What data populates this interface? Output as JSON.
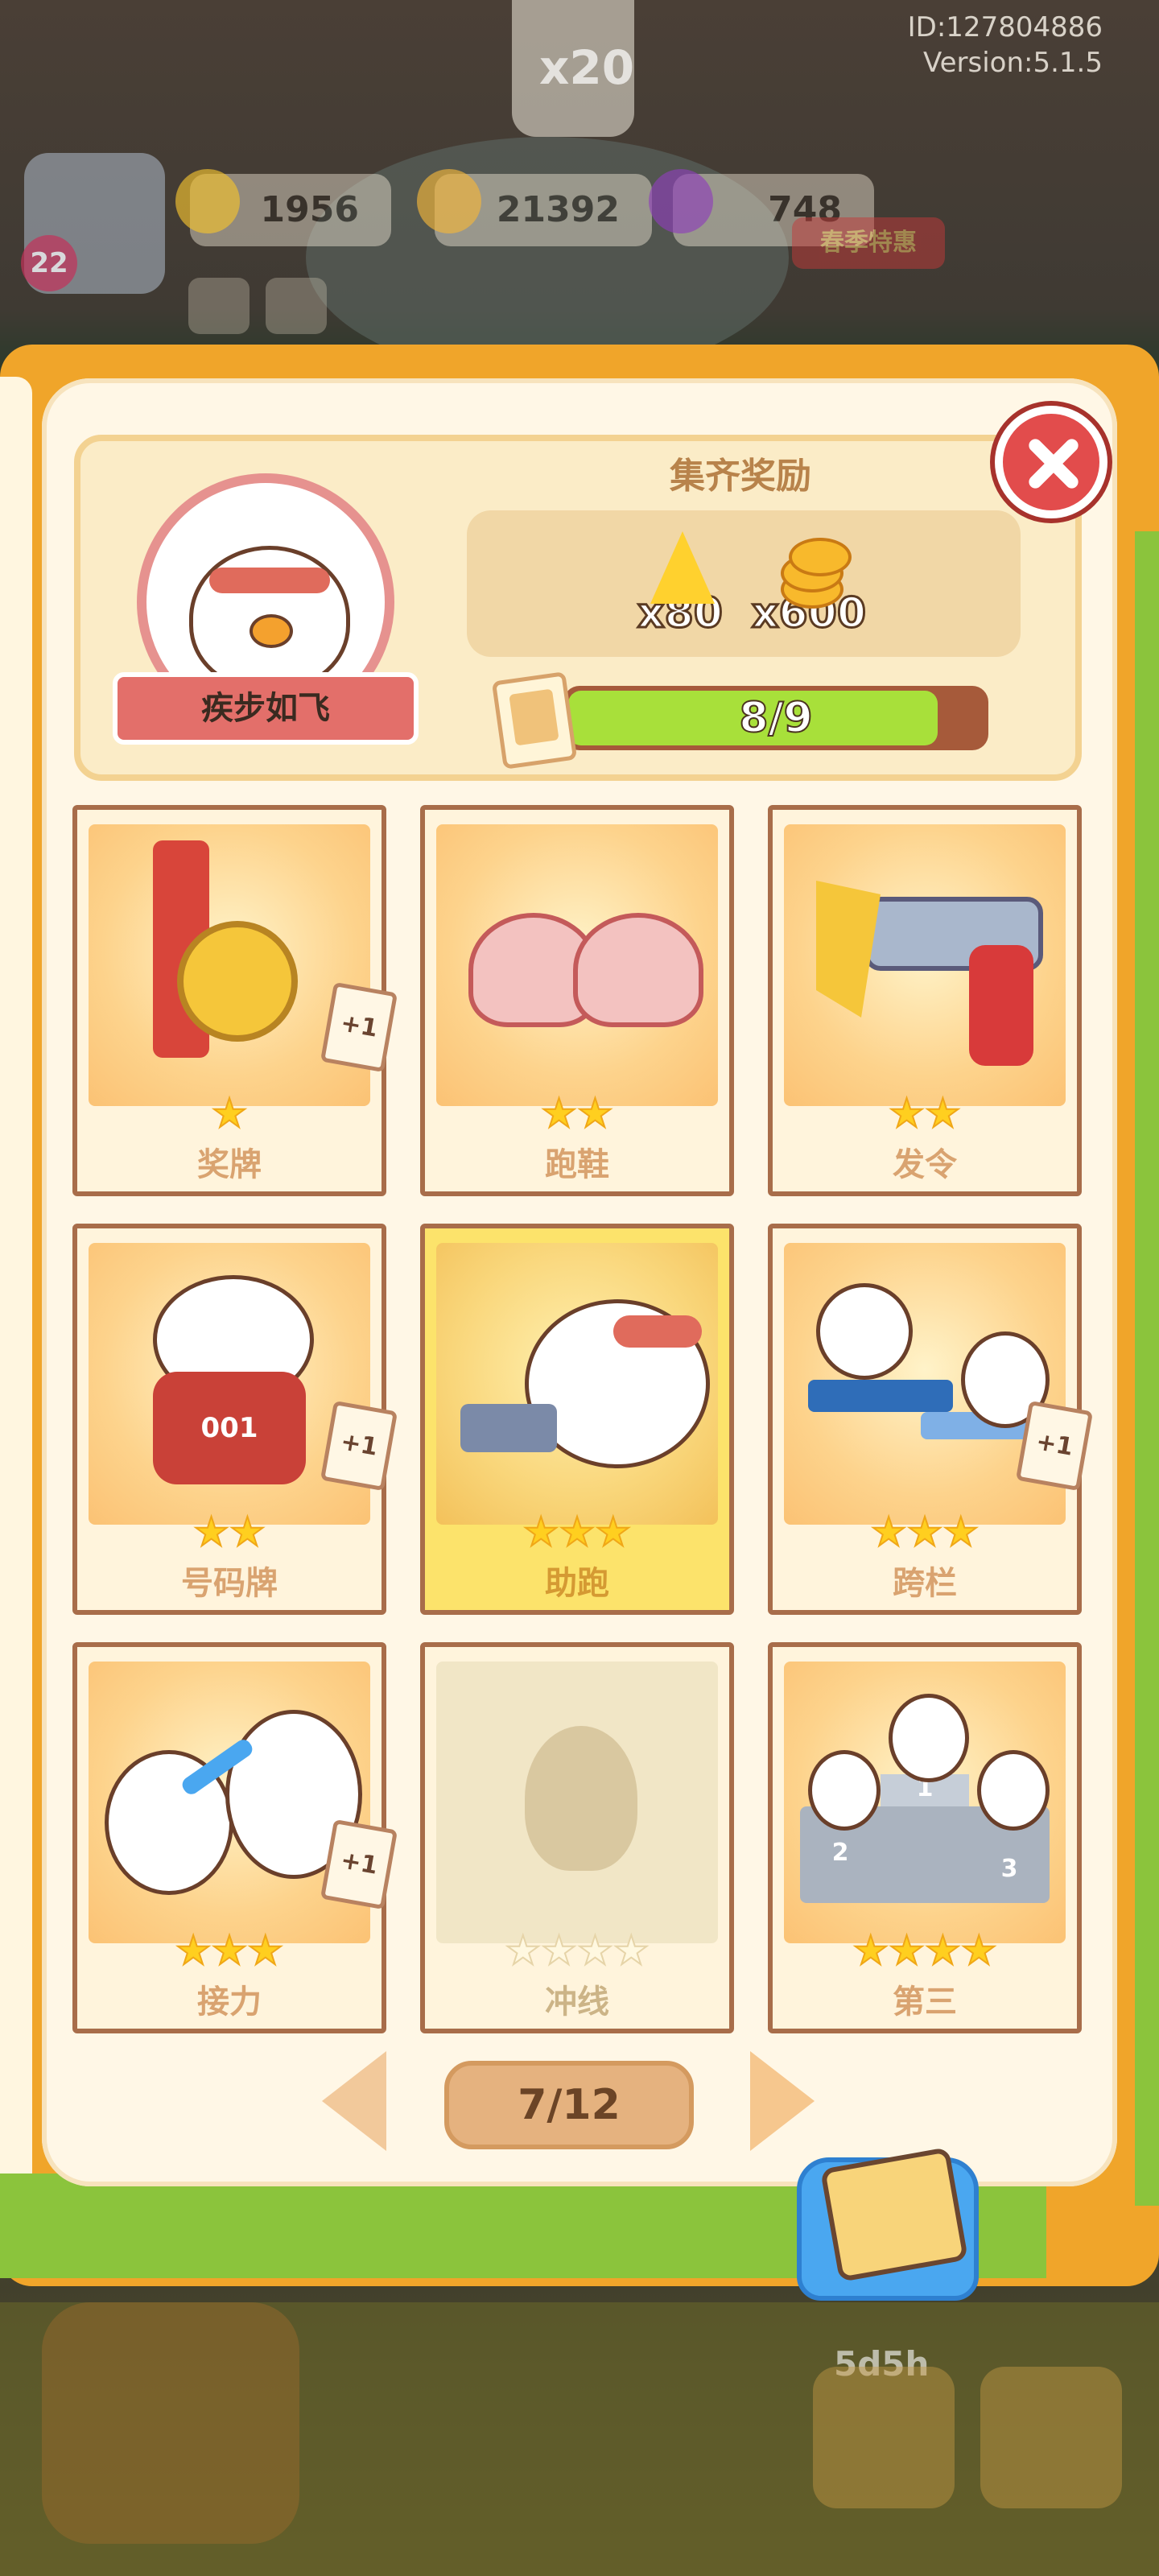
{
  "hud": {
    "id_text": "ID:127804886",
    "version_text": "Version:5.1.5",
    "speech_multiplier": "x20",
    "level": "22",
    "energy": "1956",
    "coins": "21392",
    "gems": "748",
    "sale_label": "春季特惠"
  },
  "collection": {
    "set_name": "疾步如飞",
    "reward_title": "集齐奖励",
    "rewards": [
      {
        "icon": "lightning-icon",
        "qty": "x80"
      },
      {
        "icon": "coin-stack-icon",
        "qty": "x600"
      }
    ],
    "progress_text": "8/9",
    "progress_value": 0.889
  },
  "cards": [
    {
      "name": "奖牌",
      "stars": 1,
      "max_stars": 1,
      "plus_one": true,
      "state": "normal"
    },
    {
      "name": "跑鞋",
      "stars": 2,
      "max_stars": 2,
      "plus_one": false,
      "state": "normal"
    },
    {
      "name": "发令",
      "stars": 2,
      "max_stars": 2,
      "plus_one": false,
      "state": "normal"
    },
    {
      "name": "号码牌",
      "stars": 2,
      "max_stars": 2,
      "plus_one": true,
      "state": "normal"
    },
    {
      "name": "助跑",
      "stars": 3,
      "max_stars": 3,
      "plus_one": false,
      "state": "gold"
    },
    {
      "name": "跨栏",
      "stars": 3,
      "max_stars": 3,
      "plus_one": true,
      "state": "normal"
    },
    {
      "name": "接力",
      "stars": 3,
      "max_stars": 3,
      "plus_one": true,
      "state": "normal"
    },
    {
      "name": "冲线",
      "stars": 0,
      "max_stars": 4,
      "plus_one": false,
      "state": "locked"
    },
    {
      "name": "第三",
      "stars": 4,
      "max_stars": 4,
      "plus_one": false,
      "state": "normal"
    }
  ],
  "card_plus_label": "+1",
  "card_art_numbers": {
    "bib": "001",
    "podium_1": "1",
    "podium_2": "2",
    "podium_3": "3"
  },
  "pagination": {
    "text": "7/12"
  },
  "bottom": {
    "timer": "5d5h"
  },
  "colors": {
    "accent": "#f0a52a",
    "progress_fill": "#a8e03a",
    "close": "#e24c4c",
    "star": "#ffcf1f"
  }
}
